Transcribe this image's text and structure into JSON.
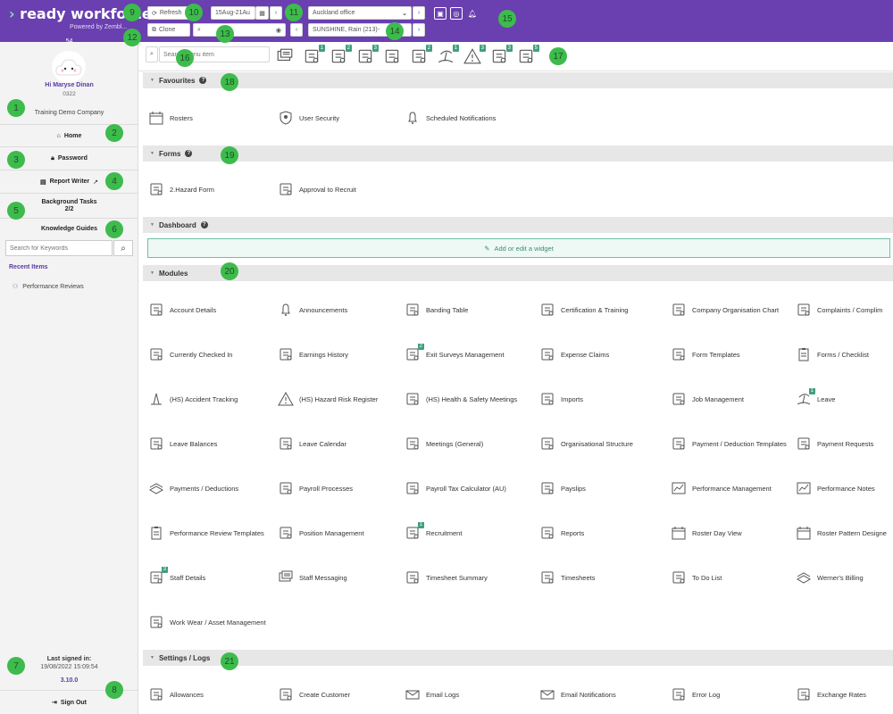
{
  "app": {
    "brand": "ready workforce",
    "powered_by": "Powered by Zembl...",
    "colors": {
      "topbar": "#6a3fb0",
      "accent": "#3dbb4c",
      "badge_tag": "#3fa07a"
    }
  },
  "topbar": {
    "refresh_label": "Refresh",
    "clone_label": "Clone",
    "date_range": "15Aug-21Au",
    "office_select": "Auckland office",
    "weather": "SUNSHINE, Rain (213)-"
  },
  "callouts": [
    "1",
    "2",
    "3",
    "4",
    "5",
    "6",
    "7",
    "8",
    "9",
    "10",
    "11",
    "12",
    "13",
    "14",
    "15",
    "16",
    "17",
    "18",
    "19",
    "20",
    "21"
  ],
  "sidebar": {
    "counter": "54",
    "greeting": "Hi Maryse Dinan",
    "user_id": "0322",
    "company": "Training Demo Company",
    "home": "Home",
    "password": "Password",
    "report_writer": "Report Writer",
    "background_tasks_label": "Background Tasks",
    "background_tasks_count": "2/2",
    "knowledge_guides": "Knowledge Guides",
    "search_placeholder": "Search for Keywords",
    "recent_items_label": "Recent Items",
    "recent_items": [
      "Performance Reviews"
    ],
    "last_signed_in_label": "Last signed in:",
    "last_signed_in": "19/08/2022 15:09:54",
    "version": "3.10.0",
    "sign_out": "Sign Out"
  },
  "menu_search_placeholder": "Search menu item",
  "toolbar_icons": [
    {
      "name": "messages-icon",
      "badge": ""
    },
    {
      "name": "team-icon",
      "badge": "1"
    },
    {
      "name": "id-cards-icon",
      "badge": "2"
    },
    {
      "name": "staff-card-icon",
      "badge": "3"
    },
    {
      "name": "box-icon",
      "badge": ""
    },
    {
      "name": "award-icon",
      "badge": "2"
    },
    {
      "name": "beach-icon",
      "badge": "1"
    },
    {
      "name": "warning-icon",
      "badge": "3"
    },
    {
      "name": "checklist-icon",
      "badge": "3"
    },
    {
      "name": "list-icon",
      "badge": "5"
    }
  ],
  "sections": {
    "favourites": "Favourites",
    "forms": "Forms",
    "dashboard": "Dashboard",
    "modules": "Modules",
    "settings": "Settings / Logs"
  },
  "favourites": [
    {
      "label": "Rosters",
      "icon": "calendar-icon"
    },
    {
      "label": "User Security",
      "icon": "shield-icon"
    },
    {
      "label": "Scheduled Notifications",
      "icon": "bell-icon"
    }
  ],
  "forms": [
    {
      "label": "2.Hazard Form",
      "icon": "form-icon"
    },
    {
      "label": "Approval to Recruit",
      "icon": "approval-icon"
    }
  ],
  "dashboard_add": "Add or edit a widget",
  "modules": [
    {
      "label": "Account Details",
      "icon": "briefcase-icon",
      "badge": ""
    },
    {
      "label": "Announcements",
      "icon": "bell-icon",
      "badge": ""
    },
    {
      "label": "Banding Table",
      "icon": "banding-icon",
      "badge": ""
    },
    {
      "label": "Certification & Training",
      "icon": "certificate-icon",
      "badge": ""
    },
    {
      "label": "Company Organisation Chart",
      "icon": "org-chart-icon",
      "badge": ""
    },
    {
      "label": "Complaints / Complim",
      "icon": "user-gear-icon",
      "badge": ""
    },
    {
      "label": "Currently Checked In",
      "icon": "user-monitor-icon",
      "badge": ""
    },
    {
      "label": "Earnings History",
      "icon": "search-graph-icon",
      "badge": ""
    },
    {
      "label": "Exit Surveys Management",
      "icon": "id-cards-icon",
      "badge": "2"
    },
    {
      "label": "Expense Claims",
      "icon": "wallet-icon",
      "badge": ""
    },
    {
      "label": "Form Templates",
      "icon": "list-blocks-icon",
      "badge": ""
    },
    {
      "label": "Forms / Checklist",
      "icon": "clipboard-icon",
      "badge": ""
    },
    {
      "label": "(HS) Accident Tracking",
      "icon": "cone-icon",
      "badge": ""
    },
    {
      "label": "(HS) Hazard Risk Register",
      "icon": "warning-icon",
      "badge": ""
    },
    {
      "label": "(HS) Health & Safety Meetings",
      "icon": "calendar-clock-icon",
      "badge": ""
    },
    {
      "label": "Imports",
      "icon": "import-icon",
      "badge": ""
    },
    {
      "label": "Job Management",
      "icon": "building-icon",
      "badge": ""
    },
    {
      "label": "Leave",
      "icon": "beach-icon",
      "badge": "1"
    },
    {
      "label": "Leave Balances",
      "icon": "balance-icon",
      "badge": ""
    },
    {
      "label": "Leave Calendar",
      "icon": "calendar-grid-icon",
      "badge": ""
    },
    {
      "label": "Meetings (General)",
      "icon": "calendar-clock-icon",
      "badge": ""
    },
    {
      "label": "Organisational Structure",
      "icon": "structure-icon",
      "badge": ""
    },
    {
      "label": "Payment / Deduction Templates",
      "icon": "document-icon",
      "badge": ""
    },
    {
      "label": "Payment Requests",
      "icon": "payment-request-icon",
      "badge": ""
    },
    {
      "label": "Payments / Deductions",
      "icon": "money-stack-icon",
      "badge": ""
    },
    {
      "label": "Payroll Processes",
      "icon": "payroll-icon",
      "badge": ""
    },
    {
      "label": "Payroll Tax Calculator (AU)",
      "icon": "calculator-icon",
      "badge": ""
    },
    {
      "label": "Payslips",
      "icon": "payslip-icon",
      "badge": ""
    },
    {
      "label": "Performance Management",
      "icon": "chart-icon",
      "badge": ""
    },
    {
      "label": "Performance Notes",
      "icon": "chart-icon",
      "badge": ""
    },
    {
      "label": "Performance Review Templates",
      "icon": "clipboard-icon",
      "badge": ""
    },
    {
      "label": "Position Management",
      "icon": "users-gear-icon",
      "badge": ""
    },
    {
      "label": "Recruitment",
      "icon": "team-icon",
      "badge": "1"
    },
    {
      "label": "Reports",
      "icon": "report-icon",
      "badge": ""
    },
    {
      "label": "Roster Day View",
      "icon": "calendar-icon",
      "badge": ""
    },
    {
      "label": "Roster Pattern Designe",
      "icon": "calendar-icon",
      "badge": ""
    },
    {
      "label": "Staff Details",
      "icon": "staff-card-icon",
      "badge": "3"
    },
    {
      "label": "Staff Messaging",
      "icon": "messages-icon",
      "badge": ""
    },
    {
      "label": "Timesheet Summary",
      "icon": "timesheet-icon",
      "badge": ""
    },
    {
      "label": "Timesheets",
      "icon": "timesheet-edit-icon",
      "badge": ""
    },
    {
      "label": "To Do List",
      "icon": "todo-icon",
      "badge": ""
    },
    {
      "label": "Werner's Billing",
      "icon": "money-stack-icon",
      "badge": ""
    },
    {
      "label": "Work Wear / Asset Management",
      "icon": "asset-icon",
      "badge": ""
    }
  ],
  "settings": [
    {
      "label": "Allowances",
      "icon": "user-gear-icon"
    },
    {
      "label": "Create Customer",
      "icon": "user-gear-icon"
    },
    {
      "label": "Email Logs",
      "icon": "email-icon"
    },
    {
      "label": "Email Notifications",
      "icon": "email-icon"
    },
    {
      "label": "Error Log",
      "icon": "error-log-icon"
    },
    {
      "label": "Exchange Rates",
      "icon": "exchange-icon"
    }
  ]
}
